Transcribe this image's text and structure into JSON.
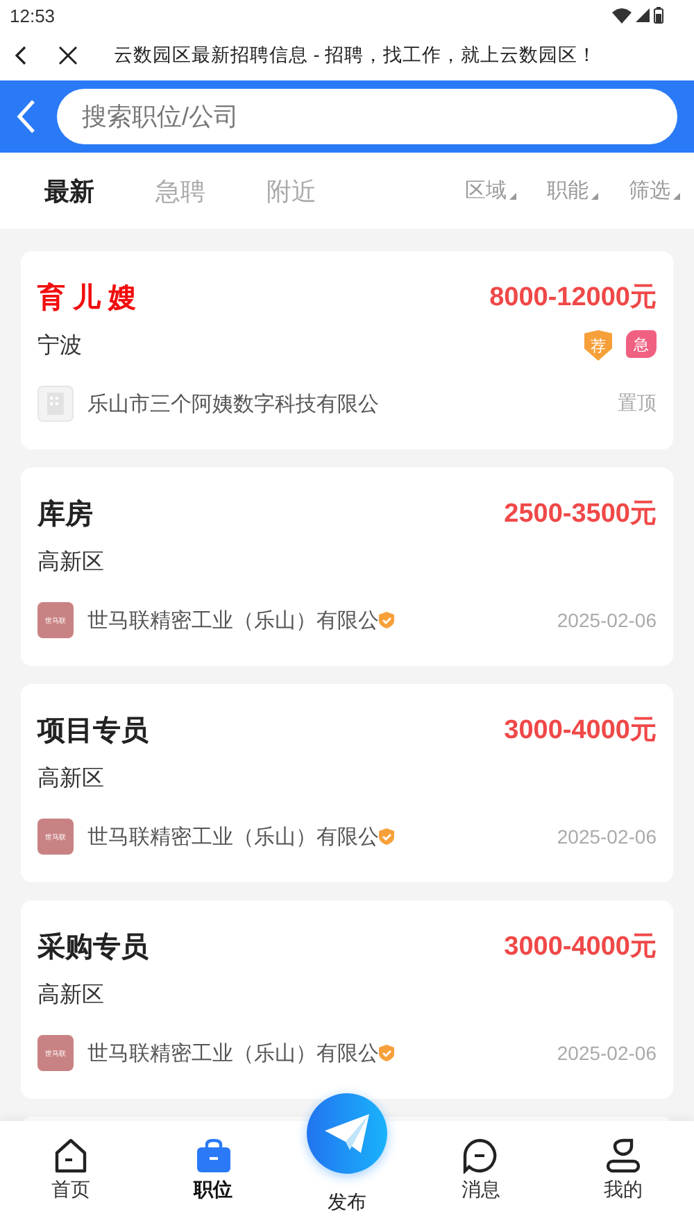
{
  "status_bar": {
    "time": "12:53"
  },
  "browser_bar": {
    "title": "云数园区最新招聘信息 - 招聘，找工作，就上云数园区！"
  },
  "search": {
    "placeholder": "搜索职位/公司"
  },
  "tabs": [
    {
      "label": "最新",
      "selected": true
    },
    {
      "label": "急聘",
      "selected": false
    },
    {
      "label": "附近",
      "selected": false
    }
  ],
  "filters": [
    {
      "label": "区域"
    },
    {
      "label": "职能"
    },
    {
      "label": "筛选"
    }
  ],
  "jobs": [
    {
      "title": "育 儿 嫂",
      "salary": "8000-12000元",
      "location": "宁波",
      "highlighted": true,
      "tags": [
        {
          "label": "荐",
          "kind": "shield"
        },
        {
          "label": "急",
          "kind": "urgent"
        }
      ],
      "logo": {
        "kind": "placeholder"
      },
      "company": "乐山市三个阿姨数字科技有限公",
      "verified": false,
      "meta": "置顶"
    },
    {
      "title": "库房",
      "salary": "2500-3500元",
      "location": "高新区",
      "highlighted": false,
      "logo": {
        "kind": "text",
        "text": "世马联"
      },
      "company": "世马联精密工业（乐山）有限公",
      "verified": true,
      "meta": "2025-02-06"
    },
    {
      "title": "项目专员",
      "salary": "3000-4000元",
      "location": "高新区",
      "highlighted": false,
      "logo": {
        "kind": "text",
        "text": "世马联"
      },
      "company": "世马联精密工业（乐山）有限公",
      "verified": true,
      "meta": "2025-02-06"
    },
    {
      "title": "采购专员",
      "salary": "3000-4000元",
      "location": "高新区",
      "highlighted": false,
      "logo": {
        "kind": "text",
        "text": "世马联"
      },
      "company": "世马联精密工业（乐山）有限公",
      "verified": true,
      "meta": "2025-02-06"
    }
  ],
  "bottom_nav": [
    {
      "label": "首页",
      "kind": "tab",
      "selected": false
    },
    {
      "label": "职位",
      "kind": "tab",
      "selected": true
    },
    {
      "label": "发布",
      "kind": "fab"
    },
    {
      "label": "消息",
      "kind": "tab",
      "selected": false
    },
    {
      "label": "我的",
      "kind": "tab",
      "selected": false
    }
  ]
}
